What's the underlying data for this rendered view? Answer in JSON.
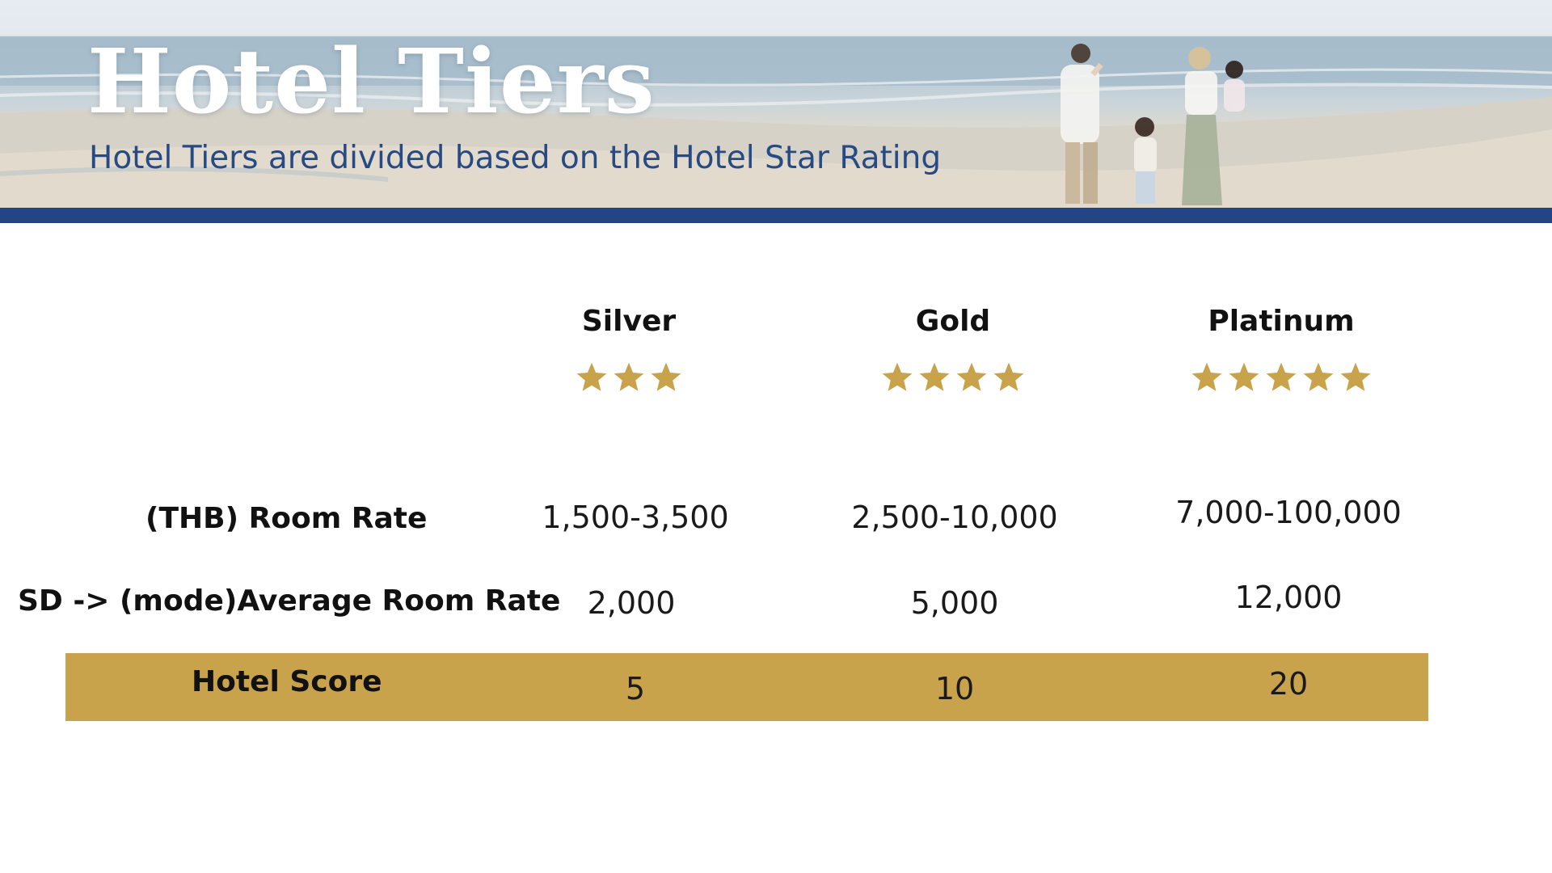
{
  "header": {
    "title": "Hotel Tiers",
    "subtitle": "Hotel Tiers are divided based on the Hotel Star Rating"
  },
  "colors": {
    "accent_gold": "#c9a24c",
    "star_gold": "#c9a24c",
    "navy": "#244583",
    "subtitle_blue": "#274a85"
  },
  "table": {
    "tiers": [
      {
        "name": "Silver",
        "stars": 3
      },
      {
        "name": "Gold",
        "stars": 4
      },
      {
        "name": "Platinum",
        "stars": 5
      }
    ],
    "rows": [
      {
        "label": "(THB) Room Rate",
        "values": [
          "1,500-3,500",
          "2,500-10,000",
          "7,000-100,000"
        ]
      },
      {
        "label": "SD -> (mode)Average Room Rate",
        "values": [
          "2,000",
          "5,000",
          "12,000"
        ]
      },
      {
        "label": "Hotel Score",
        "values": [
          "5",
          "10",
          "20"
        ]
      }
    ]
  },
  "icons": {
    "rating": "star-icon"
  }
}
